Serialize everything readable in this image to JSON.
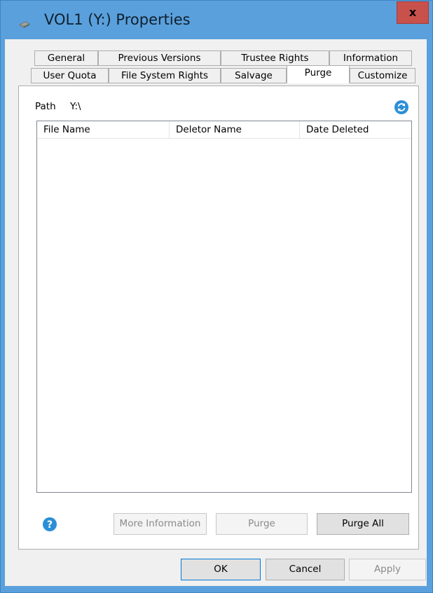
{
  "window": {
    "title": "VOL1 (Y:) Properties",
    "close_label": "x"
  },
  "tabs": {
    "row1": [
      {
        "label": "General"
      },
      {
        "label": "Previous Versions"
      },
      {
        "label": "Trustee Rights"
      },
      {
        "label": "Information"
      }
    ],
    "row2": [
      {
        "label": "User Quota"
      },
      {
        "label": "File System Rights"
      },
      {
        "label": "Salvage"
      },
      {
        "label": "Purge",
        "active": true
      },
      {
        "label": "Customize"
      }
    ]
  },
  "purge": {
    "path_label": "Path",
    "path_value": "Y:\\",
    "refresh_icon": "refresh-icon",
    "columns": [
      "File Name",
      "Deletor Name",
      "Date Deleted"
    ],
    "rows": [],
    "help_icon": "help-icon",
    "more_info_label": "More Information",
    "purge_label": "Purge",
    "purge_all_label": "Purge All"
  },
  "footer": {
    "ok_label": "OK",
    "cancel_label": "Cancel",
    "apply_label": "Apply"
  },
  "colors": {
    "titlebar": "#5aa0dc",
    "close_button": "#c9514c",
    "accent": "#0078d7"
  }
}
